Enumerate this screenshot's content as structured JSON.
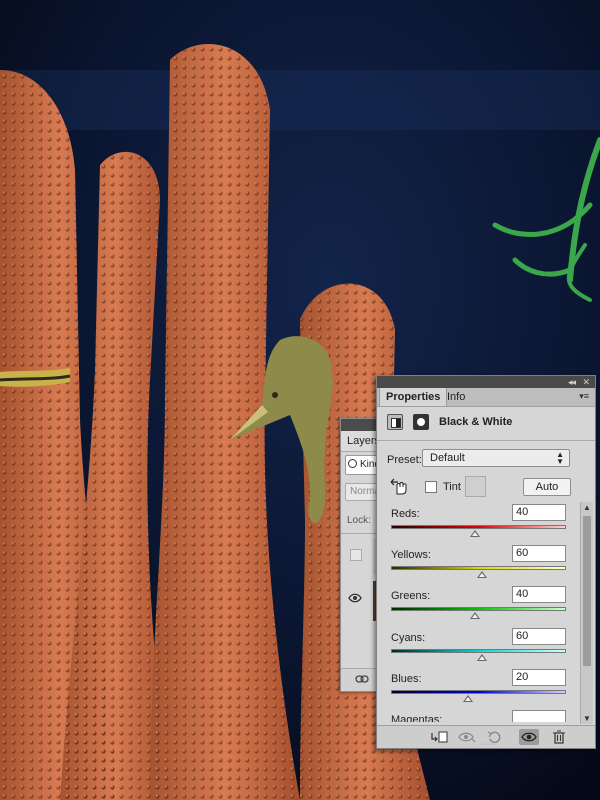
{
  "layers_panel": {
    "tab_label": "Layers",
    "kind_filter": "Kind",
    "blend_mode": "Normal",
    "lock_label": "Lock:"
  },
  "properties_panel": {
    "tabs": [
      {
        "label": "Properties",
        "active": true
      },
      {
        "label": "Info",
        "active": false
      }
    ],
    "adjustment_title": "Black & White",
    "preset_label": "Preset:",
    "preset_value": "Default",
    "tint_label": "Tint",
    "tint_checked": false,
    "auto_button": "Auto",
    "sliders": [
      {
        "label": "Reds:",
        "value": "40",
        "gradient": [
          "#2a0000",
          "#e10000",
          "#ffd0d0"
        ]
      },
      {
        "label": "Yellows:",
        "value": "60",
        "gradient": [
          "#2a2a00",
          "#d8d800",
          "#ffffd0"
        ]
      },
      {
        "label": "Greens:",
        "value": "40",
        "gradient": [
          "#002a00",
          "#00c800",
          "#d0ffd0"
        ]
      },
      {
        "label": "Cyans:",
        "value": "60",
        "gradient": [
          "#002a2a",
          "#00d8d8",
          "#d0ffff"
        ]
      },
      {
        "label": "Blues:",
        "value": "20",
        "gradient": [
          "#00002a",
          "#0000e0",
          "#d0d0ff"
        ]
      },
      {
        "label": "Magentas:",
        "value": ""
      }
    ]
  },
  "colors": {
    "panel_bg": "#d6d6d6",
    "title_bar": "#4a4a4a",
    "water": "#0b1326",
    "coral": "#c86c48"
  }
}
